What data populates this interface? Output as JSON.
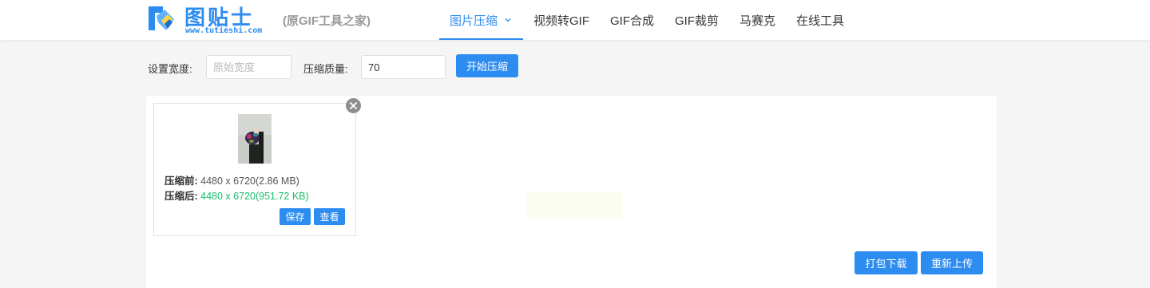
{
  "brand": {
    "name": "图贴士",
    "url": "www.tutieshi.com",
    "slogan": "(原GIF工具之家)",
    "accent": "#2d8cf0"
  },
  "nav": {
    "items": [
      {
        "label": "图片压缩",
        "active": true,
        "icon": "chevron-down-icon"
      },
      {
        "label": "视频转GIF"
      },
      {
        "label": "GIF合成"
      },
      {
        "label": "GIF裁剪"
      },
      {
        "label": "马赛克"
      },
      {
        "label": "在线工具"
      }
    ]
  },
  "settings": {
    "width_label": "设置宽度:",
    "width_placeholder": "原始宽度",
    "width_value": "",
    "quality_label": "压缩质量:",
    "quality_value": "70",
    "start_button": "开始压缩"
  },
  "file_card": {
    "before_label": "压缩前:",
    "before_value": "4480 x 6720(2.86 MB)",
    "after_label": "压缩后:",
    "after_value": "4480 x 6720(951.72 KB)",
    "after_color": "#19be6b",
    "save_button": "保存",
    "view_button": "查看",
    "remove_icon": "close-icon"
  },
  "actions": {
    "download_all": "打包下载",
    "reupload": "重新上传"
  }
}
